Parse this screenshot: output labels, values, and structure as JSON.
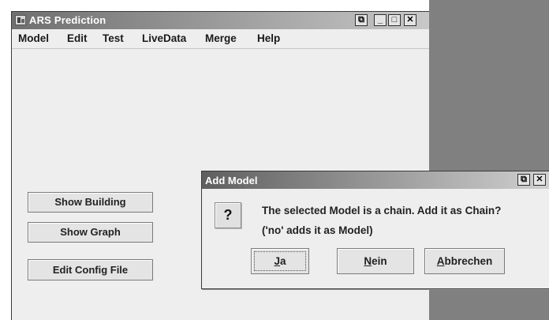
{
  "main_window": {
    "title": "ARS Prediction",
    "controls": {
      "extra": "⧉",
      "minimize": "_",
      "maximize": "□",
      "close": "✕"
    }
  },
  "menu": [
    "Model",
    "Edit",
    "Test",
    "LiveData",
    "Merge",
    "Help"
  ],
  "buttons": {
    "show_building": "Show Building",
    "show_graph": "Show Graph",
    "edit_config": "Edit Config File"
  },
  "dialog": {
    "title": "Add Model",
    "controls": {
      "extra": "⧉",
      "close": "✕"
    },
    "icon": "?",
    "message_line1": "The selected Model is a chain. Add it as Chain?",
    "message_line2": "('no' adds it as Model)",
    "buttons": {
      "yes": {
        "mnemonic": "J",
        "rest": "a"
      },
      "no": {
        "mnemonic": "N",
        "rest": "ein"
      },
      "cancel": {
        "mnemonic": "A",
        "rest": "bbrechen"
      }
    }
  }
}
